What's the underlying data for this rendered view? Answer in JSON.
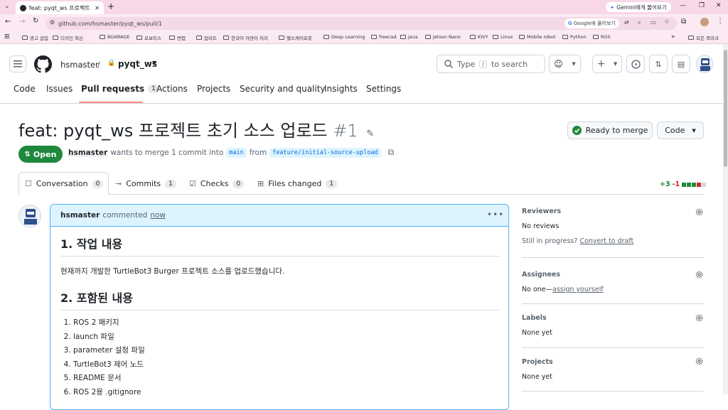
{
  "browser": {
    "tab_title": "feat: pyqt_ws 프로젝트 초기 소",
    "gemini_label": "Gemini에게 물어보기",
    "url": "github.com/hsmaster/pyqt_ws/pull/1",
    "google_ask": "Google에 물어보기",
    "all_bookmarks": "모든 북마크",
    "bookmarks": [
      "광고 삽입",
      "디자인 혁신",
      "BGARAGE",
      "로보티스",
      "면접",
      "업비트",
      "한국어 자연어 처리",
      "헬스케어로봇",
      "Deep Learning",
      "freecad",
      "Java",
      "Jetson Nano",
      "KIVY",
      "Linux",
      "Mobile robot",
      "Python",
      "ROS"
    ]
  },
  "repo": {
    "owner": "hsmaster",
    "separator": "/",
    "name": "pyqt_ws"
  },
  "search": {
    "type_label": "Type",
    "slash": "/",
    "to_search": "to search"
  },
  "nav": {
    "tabs": [
      {
        "label": "Code"
      },
      {
        "label": "Issues"
      },
      {
        "label": "Pull requests",
        "count": "1"
      },
      {
        "label": "Actions"
      },
      {
        "label": "Projects"
      },
      {
        "label": "Security and quality"
      },
      {
        "label": "Insights"
      },
      {
        "label": "Settings"
      }
    ]
  },
  "pr": {
    "title": "feat: pyqt_ws 프로젝트 초기 소스 업로드",
    "number": "#1",
    "ready_button": "Ready to merge",
    "code_button": "Code",
    "state": "Open",
    "author": "hsmaster",
    "merge_text": "wants to merge 1 commit into",
    "base_branch": "main",
    "from_text": "from",
    "head_branch": "feature/initial-source-upload",
    "tabs": [
      {
        "label": "Conversation",
        "count": "0"
      },
      {
        "label": "Commits",
        "count": "1"
      },
      {
        "label": "Checks",
        "count": "0"
      },
      {
        "label": "Files changed",
        "count": "1"
      }
    ],
    "additions": "+3",
    "deletions": "-1"
  },
  "comment": {
    "author": "hsmaster",
    "action": "commented",
    "time": "now",
    "h1": "1. 작업 내용",
    "p1": "현재까지 개발한 TurtleBot3 Burger 프로젝트 소스를 업로드했습니다.",
    "h2": "2. 포함된 내용",
    "items": [
      "ROS 2 패키지",
      "launch 파일",
      "parameter 설정 파일",
      "TurtleBot3 제어 노드",
      "README 문서",
      "ROS 2용 .gitignore"
    ]
  },
  "sidebar": {
    "reviewers_h": "Reviewers",
    "reviewers_v": "No reviews",
    "in_progress": "Still in progress?",
    "convert": "Convert to draft",
    "assignees_h": "Assignees",
    "assignees_v": "No one—",
    "assign_yourself": "assign yourself",
    "labels_h": "Labels",
    "labels_v": "None yet",
    "projects_h": "Projects",
    "projects_v": "None yet"
  },
  "colors": {
    "green": "#1f883d",
    "link": "#0969da",
    "border": "#d0d7de"
  }
}
